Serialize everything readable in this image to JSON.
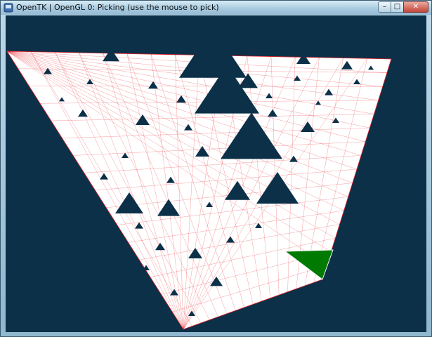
{
  "window": {
    "title": "OpenTK | OpenGL 0: Picking (use the mouse to pick)",
    "controls": {
      "minimize": "–",
      "maximize": "□",
      "close": "✕"
    },
    "icon": "opentk-app-icon"
  },
  "viewport": {
    "background_color": "#0b3048",
    "fill_color": "#ffffff",
    "edge_color": "#e8232b",
    "picked_color": "#007a00",
    "picked_item": "picked-triangle",
    "icons": [
      "sierpinski-fractal-render",
      "picked-triangle"
    ]
  }
}
